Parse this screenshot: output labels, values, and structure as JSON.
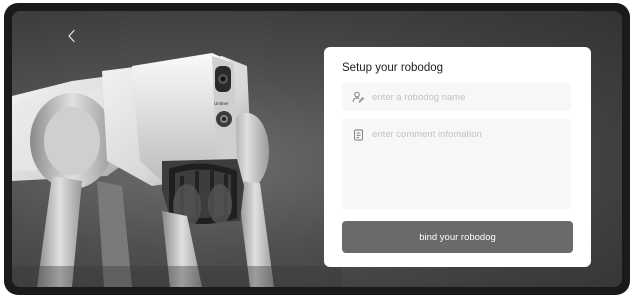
{
  "header": {
    "back_icon": "chevron-left-icon"
  },
  "setup_card": {
    "title": "Setup your robodog",
    "name_field": {
      "icon": "user-edit-icon",
      "value": "",
      "placeholder": "enter a robodog name"
    },
    "comment_field": {
      "icon": "note-icon",
      "value": "",
      "placeholder": "enter comment infomation"
    },
    "bind_button_label": "bind your robodog"
  },
  "robot_image": {
    "brand_label": "Unitree"
  },
  "colors": {
    "background": "#4a4a4a",
    "card": "#ffffff",
    "button": "#6a6a6a",
    "field": "#f7f7f7"
  }
}
